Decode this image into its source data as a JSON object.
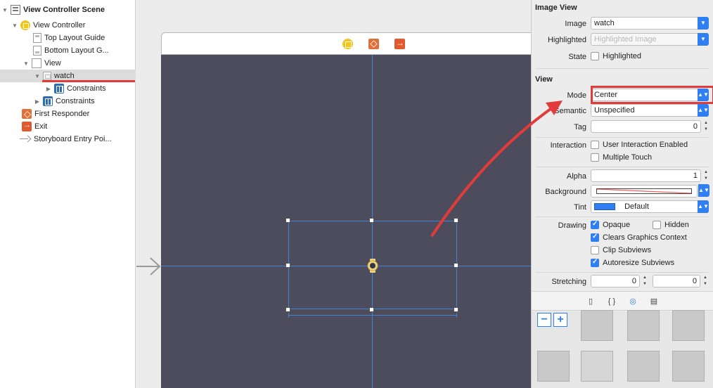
{
  "outline": {
    "items": [
      {
        "label": "View Controller Scene"
      },
      {
        "label": "View Controller"
      },
      {
        "label": "Top Layout Guide"
      },
      {
        "label": "Bottom Layout G..."
      },
      {
        "label": "View"
      },
      {
        "label": "watch"
      },
      {
        "label": "Constraints"
      },
      {
        "label": "Constraints"
      },
      {
        "label": "First Responder"
      },
      {
        "label": "Exit"
      },
      {
        "label": "Storyboard Entry Poi..."
      }
    ]
  },
  "inspector": {
    "image_view": {
      "title": "Image View",
      "image_label": "Image",
      "image_value": "watch",
      "highlighted_label": "Highlighted",
      "highlighted_placeholder": "Highlighted Image",
      "state_label": "State",
      "state_checkbox_label": "Highlighted"
    },
    "view": {
      "title": "View",
      "mode_label": "Mode",
      "mode_value": "Center",
      "semantic_label": "Semantic",
      "semantic_value": "Unspecified",
      "tag_label": "Tag",
      "tag_value": "0",
      "interaction_label": "Interaction",
      "user_interaction_label": "User Interaction Enabled",
      "multiple_touch_label": "Multiple Touch",
      "alpha_label": "Alpha",
      "alpha_value": "1",
      "background_label": "Background",
      "tint_label": "Tint",
      "tint_value": "Default",
      "tint_color": "#2f7ef2",
      "drawing_label": "Drawing",
      "opaque_label": "Opaque",
      "hidden_label": "Hidden",
      "clears_label": "Clears Graphics Context",
      "clip_label": "Clip Subviews",
      "autoresize_label": "Autoresize Subviews",
      "stretching_label": "Stretching",
      "stretch_x": "0",
      "stretch_y": "0"
    },
    "tabs": {
      "file_icon": "▯",
      "braces_icon": "{ }",
      "object_icon": "◎",
      "media_icon": "▤"
    },
    "library": {
      "minus": "−",
      "plus": "+"
    }
  },
  "colors": {
    "canvas_bg": "#4d4c5c",
    "guide_blue": "#3f82d6",
    "annotation_red": "#e23b3b",
    "accent_blue": "#2f7ef2"
  }
}
